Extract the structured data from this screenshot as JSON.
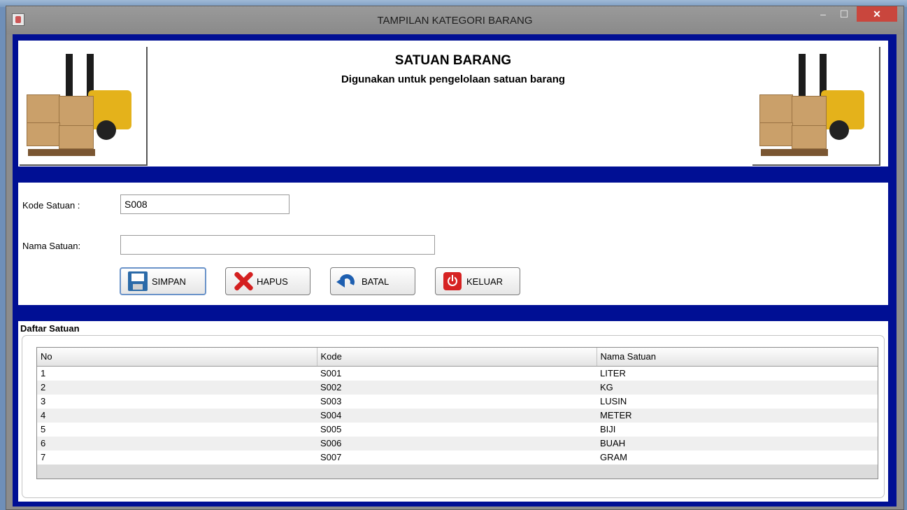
{
  "window": {
    "title": "TAMPILAN KATEGORI BARANG",
    "minimize_icon": "minimize-icon",
    "maximize_icon": "maximize-icon",
    "close_icon": "close-icon",
    "close_glyph": "✕",
    "minimize_glyph": "–",
    "maximize_glyph": "☐"
  },
  "header": {
    "title": "SATUAN BARANG",
    "subtitle": "Digunakan untuk pengelolaan satuan barang"
  },
  "form": {
    "kode_label": "Kode Satuan :",
    "kode_value": "S008",
    "nama_label": "Nama Satuan:",
    "nama_value": ""
  },
  "buttons": {
    "simpan": "SIMPAN",
    "hapus": "HAPUS",
    "batal": "BATAL",
    "keluar": "KELUAR"
  },
  "table": {
    "section_title": "Daftar Satuan",
    "columns": [
      "No",
      "Kode",
      "Nama Satuan"
    ],
    "rows": [
      [
        "1",
        "S001",
        "LITER"
      ],
      [
        "2",
        "S002",
        "KG"
      ],
      [
        "3",
        "S003",
        "LUSIN"
      ],
      [
        "4",
        "S004",
        "METER"
      ],
      [
        "5",
        "S005",
        "BIJI"
      ],
      [
        "6",
        "S006",
        "BUAH"
      ],
      [
        "7",
        "S007",
        "GRAM"
      ]
    ]
  },
  "colors": {
    "background_panel": "#000f94",
    "close_button": "#c9463d",
    "forklift": "#e4b21b"
  }
}
